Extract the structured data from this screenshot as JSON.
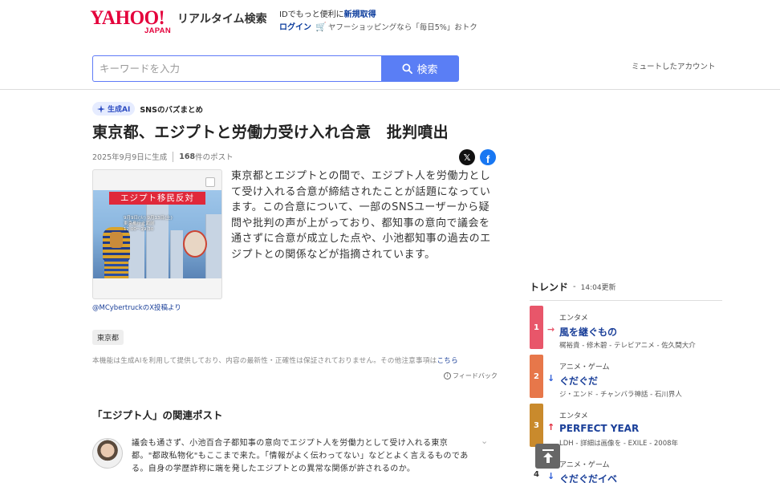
{
  "header": {
    "logo_yahoo": "YAHOO!",
    "logo_japan": "JAPAN",
    "service_name": "リアルタイム検索",
    "id_promo_prefix": "IDでもっと便利に",
    "id_promo_link": "新規取得",
    "login": "ログイン",
    "shopping_promo": "ヤフーショッピングなら「毎日5%」おトク",
    "cart_icon": "cart-icon"
  },
  "search": {
    "placeholder": "キーワードを入力",
    "button_label": "検索",
    "icon": "search-icon"
  },
  "muted_accounts_link": "ミュートしたアカウント",
  "article": {
    "ai_badge": "生成AI",
    "section_label": "SNSのバズまとめ",
    "title": "東京都、エジプトと労働力受け入れ合意　批判噴出",
    "generated_date": "2025年9月9日に生成",
    "post_count": "168",
    "post_count_suffix": "件のポスト",
    "image": {
      "banner": "エジプト移民反対",
      "caption_line1": "9月9日(火) 9月13日(土)",
      "caption_line2": "東京都庁正面前",
      "caption_line3": "12:00〜19:30"
    },
    "image_credit": "@MCybertruckのX投稿より",
    "summary": "東京都とエジプトとの間で、エジプト人を労働力として受け入れる合意が締結されたことが話題になっています。この合意について、一部のSNSユーザーから疑問や批判の声が上がっており、都知事の意向で議会を通さずに合意が成立した点や、小池都知事の過去のエジプトとの関係などが指摘されています。",
    "tag": "東京都",
    "disclaimer": "本機能は生成AIを利用して提供しており、内容の最新性・正確性は保証されておりません。その他注意事項は",
    "disclaimer_link": "こちら",
    "feedback": "フィードバック"
  },
  "related": {
    "title": "「エジプト人」の関連ポスト",
    "posts": [
      {
        "text": "議会も通さず、小池百合子都知事の意向でエジプト人を労働力として受け入れる東京都。\"都政私物化\"もここまで来た。「情報がよく伝わってない」などとよく言えるものである。自身の学歴詐称に端を発したエジプトとの異常な関係が許されるのか。"
      }
    ]
  },
  "trends": {
    "title": "トレンド",
    "updated": "14:04更新",
    "items": [
      {
        "rank": "1",
        "category": "エンタメ",
        "name": "風を継ぐもの",
        "sub": "梶裕貴 - 修木碧 - テレビアニメ - 佐久間大介",
        "direction": "right",
        "rank_color": "#e8566a",
        "arrow_color": "#e8566a"
      },
      {
        "rank": "2",
        "category": "アニメ・ゲーム",
        "name": "ぐだぐだ",
        "sub": "ジ・エンド - チャンバラ神話 - 石川界人",
        "direction": "down",
        "rank_color": "#e7774a",
        "arrow_color": "#2b5bd6"
      },
      {
        "rank": "3",
        "category": "エンタメ",
        "name": "PERFECT YEAR",
        "sub": "LDH - 詳細は画像を - EXILE - 2008年",
        "direction": "up",
        "rank_color": "#c98a2c",
        "arrow_color": "#e0283a"
      },
      {
        "rank": "4",
        "category": "アニメ・ゲーム",
        "name": "ぐだぐだイベ",
        "sub": "",
        "direction": "down",
        "rank_color": "#ffffff",
        "arrow_color": "#2b5bd6"
      }
    ]
  },
  "scroll_top_icon": "arrow-up-icon"
}
